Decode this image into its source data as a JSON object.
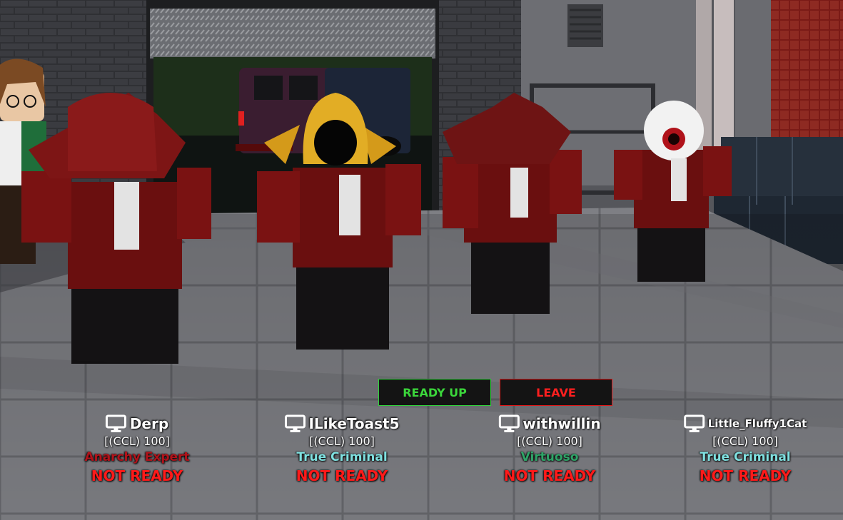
{
  "buttons": {
    "ready_label": "READY UP",
    "leave_label": "LEAVE",
    "ready_color": "#3bd63b",
    "leave_color": "#ff1f1f"
  },
  "players": [
    {
      "name": "Derp",
      "tag": "[(CCL) 100]",
      "rank": "Anarchy Expert",
      "rank_color": "#b0121a",
      "status": "NOT READY"
    },
    {
      "name": "ILikeToast5",
      "tag": "[(CCL) 100]",
      "rank": "True Criminal",
      "rank_color": "#7fe0e0",
      "status": "NOT READY"
    },
    {
      "name": "withwillin",
      "tag": "[(CCL) 100]",
      "rank": "Virtuoso",
      "rank_color": "#2fa468",
      "status": "NOT READY"
    },
    {
      "name": "Little_Fluffy1Cat",
      "tag": "[(CCL) 100]",
      "rank": "True Criminal",
      "rank_color": "#7fe0e0",
      "status": "NOT READY"
    }
  ],
  "icons": {
    "player_platform": "desktop-computer-icon"
  },
  "status_color": "#ff1a1a"
}
